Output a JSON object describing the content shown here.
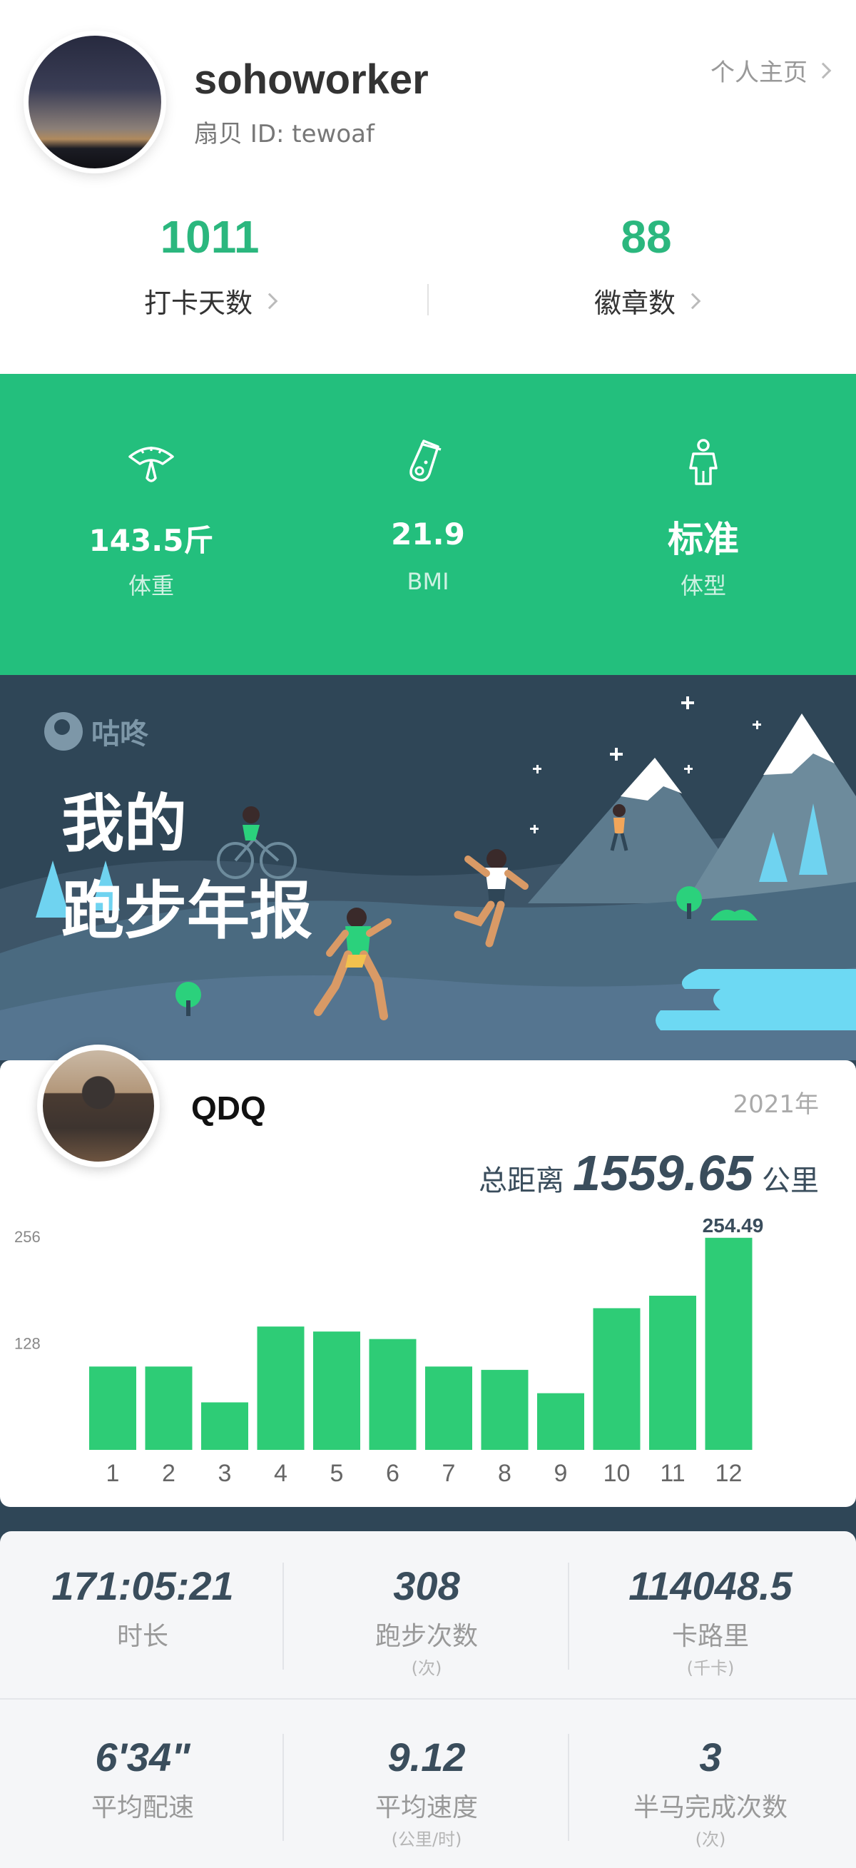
{
  "profile": {
    "username": "sohoworker",
    "user_id": "扇贝 ID: tewoaf",
    "home_link": "个人主页",
    "stats": [
      {
        "value": "1011",
        "label": "打卡天数"
      },
      {
        "value": "88",
        "label": "徽章数"
      }
    ]
  },
  "body_metrics": [
    {
      "icon": "scale-icon",
      "value": "143.5斤",
      "label": "体重"
    },
    {
      "icon": "test-tube-icon",
      "value": "21.9",
      "label": "BMI"
    },
    {
      "icon": "body-figure-icon",
      "value": "标准",
      "label": "体型"
    }
  ],
  "banner": {
    "brand": "咕咚",
    "title_line1": "我的",
    "title_line2": "跑步年报"
  },
  "report": {
    "name": "QDQ",
    "year": "2021年",
    "total_label": "总距离",
    "total_value": "1559.65",
    "total_unit": "公里"
  },
  "chart_data": {
    "type": "bar",
    "categories": [
      "1",
      "2",
      "3",
      "4",
      "5",
      "6",
      "7",
      "8",
      "9",
      "10",
      "11",
      "12"
    ],
    "values": [
      100,
      100,
      57,
      148,
      142,
      133,
      100,
      96,
      68,
      170,
      185,
      254.49
    ],
    "data_labels": [
      {
        "index": 11,
        "text": "254.49"
      }
    ],
    "y_ticks": [
      128,
      256
    ],
    "ylim": [
      0,
      256
    ],
    "color": "#2ecc76",
    "grid": false
  },
  "summary_stats": [
    {
      "value": "171:05:21",
      "label": "时长",
      "unit": ""
    },
    {
      "value": "308",
      "label": "跑步次数",
      "unit": "(次)"
    },
    {
      "value": "114048.5",
      "label": "卡路里",
      "unit": "(千卡)"
    },
    {
      "value": "6'34\"",
      "label": "平均配速",
      "unit": ""
    },
    {
      "value": "9.12",
      "label": "平均速度",
      "unit": "(公里/时)"
    },
    {
      "value": "3",
      "label": "半马完成次数",
      "unit": "(次)"
    }
  ],
  "colors": {
    "accent": "#2bb77e",
    "metrics_bg": "#23bf7d",
    "banner_bg": "#2f4657",
    "bar": "#2ecc76",
    "stat_text": "#3a4d5c"
  }
}
